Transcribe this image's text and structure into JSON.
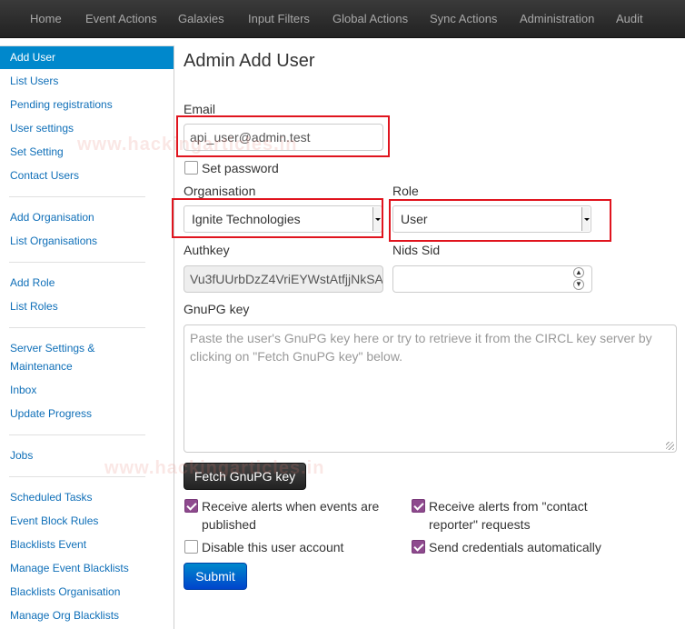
{
  "nav": [
    "Home",
    "Event Actions",
    "Galaxies",
    "Input Filters",
    "Global Actions",
    "Sync Actions",
    "Administration",
    "Audit"
  ],
  "sidebar": {
    "items": [
      "Add User",
      "List Users",
      "Pending registrations",
      "User settings",
      "Set Setting",
      "Contact Users",
      "Add Organisation",
      "List Organisations",
      "Add Role",
      "List Roles",
      "Server Settings &",
      "Maintenance",
      "Inbox",
      "Update Progress",
      "Jobs",
      "Scheduled Tasks",
      "Event Block Rules",
      "Blacklists Event",
      "Manage Event Blacklists",
      "Blacklists Organisation",
      "Manage Org Blacklists"
    ]
  },
  "form": {
    "title": "Admin Add User",
    "email_label": "Email",
    "email_value": "api_user@admin.test",
    "set_password_label": "Set password",
    "org_label": "Organisation",
    "org_value": "Ignite Technologies",
    "role_label": "Role",
    "role_value": "User",
    "authkey_label": "Authkey",
    "authkey_value": "Vu3fUUrbDzZ4VriEYWstAtfjjNkSA",
    "nids_label": "Nids Sid",
    "gpg_label": "GnuPG key",
    "gpg_placeholder": "Paste the user's GnuPG key here or try to retrieve it from the CIRCL key server by clicking on \"Fetch GnuPG key\" below.",
    "fetch_button": "Fetch GnuPG key",
    "cb_alerts_events_1": "Receive alerts when events are",
    "cb_alerts_events_2": "published",
    "cb_alerts_contact_1": "Receive alerts from \"contact",
    "cb_alerts_contact_2": "reporter\" requests",
    "cb_disable": "Disable this user account",
    "cb_send_creds": "Send credentials automatically",
    "submit_button": "Submit"
  },
  "watermark": "www.hackingarticles.in",
  "colors": {
    "accent": "#0088cc",
    "highlight": "#e0141e",
    "checkbox": "#8e4a8e"
  }
}
